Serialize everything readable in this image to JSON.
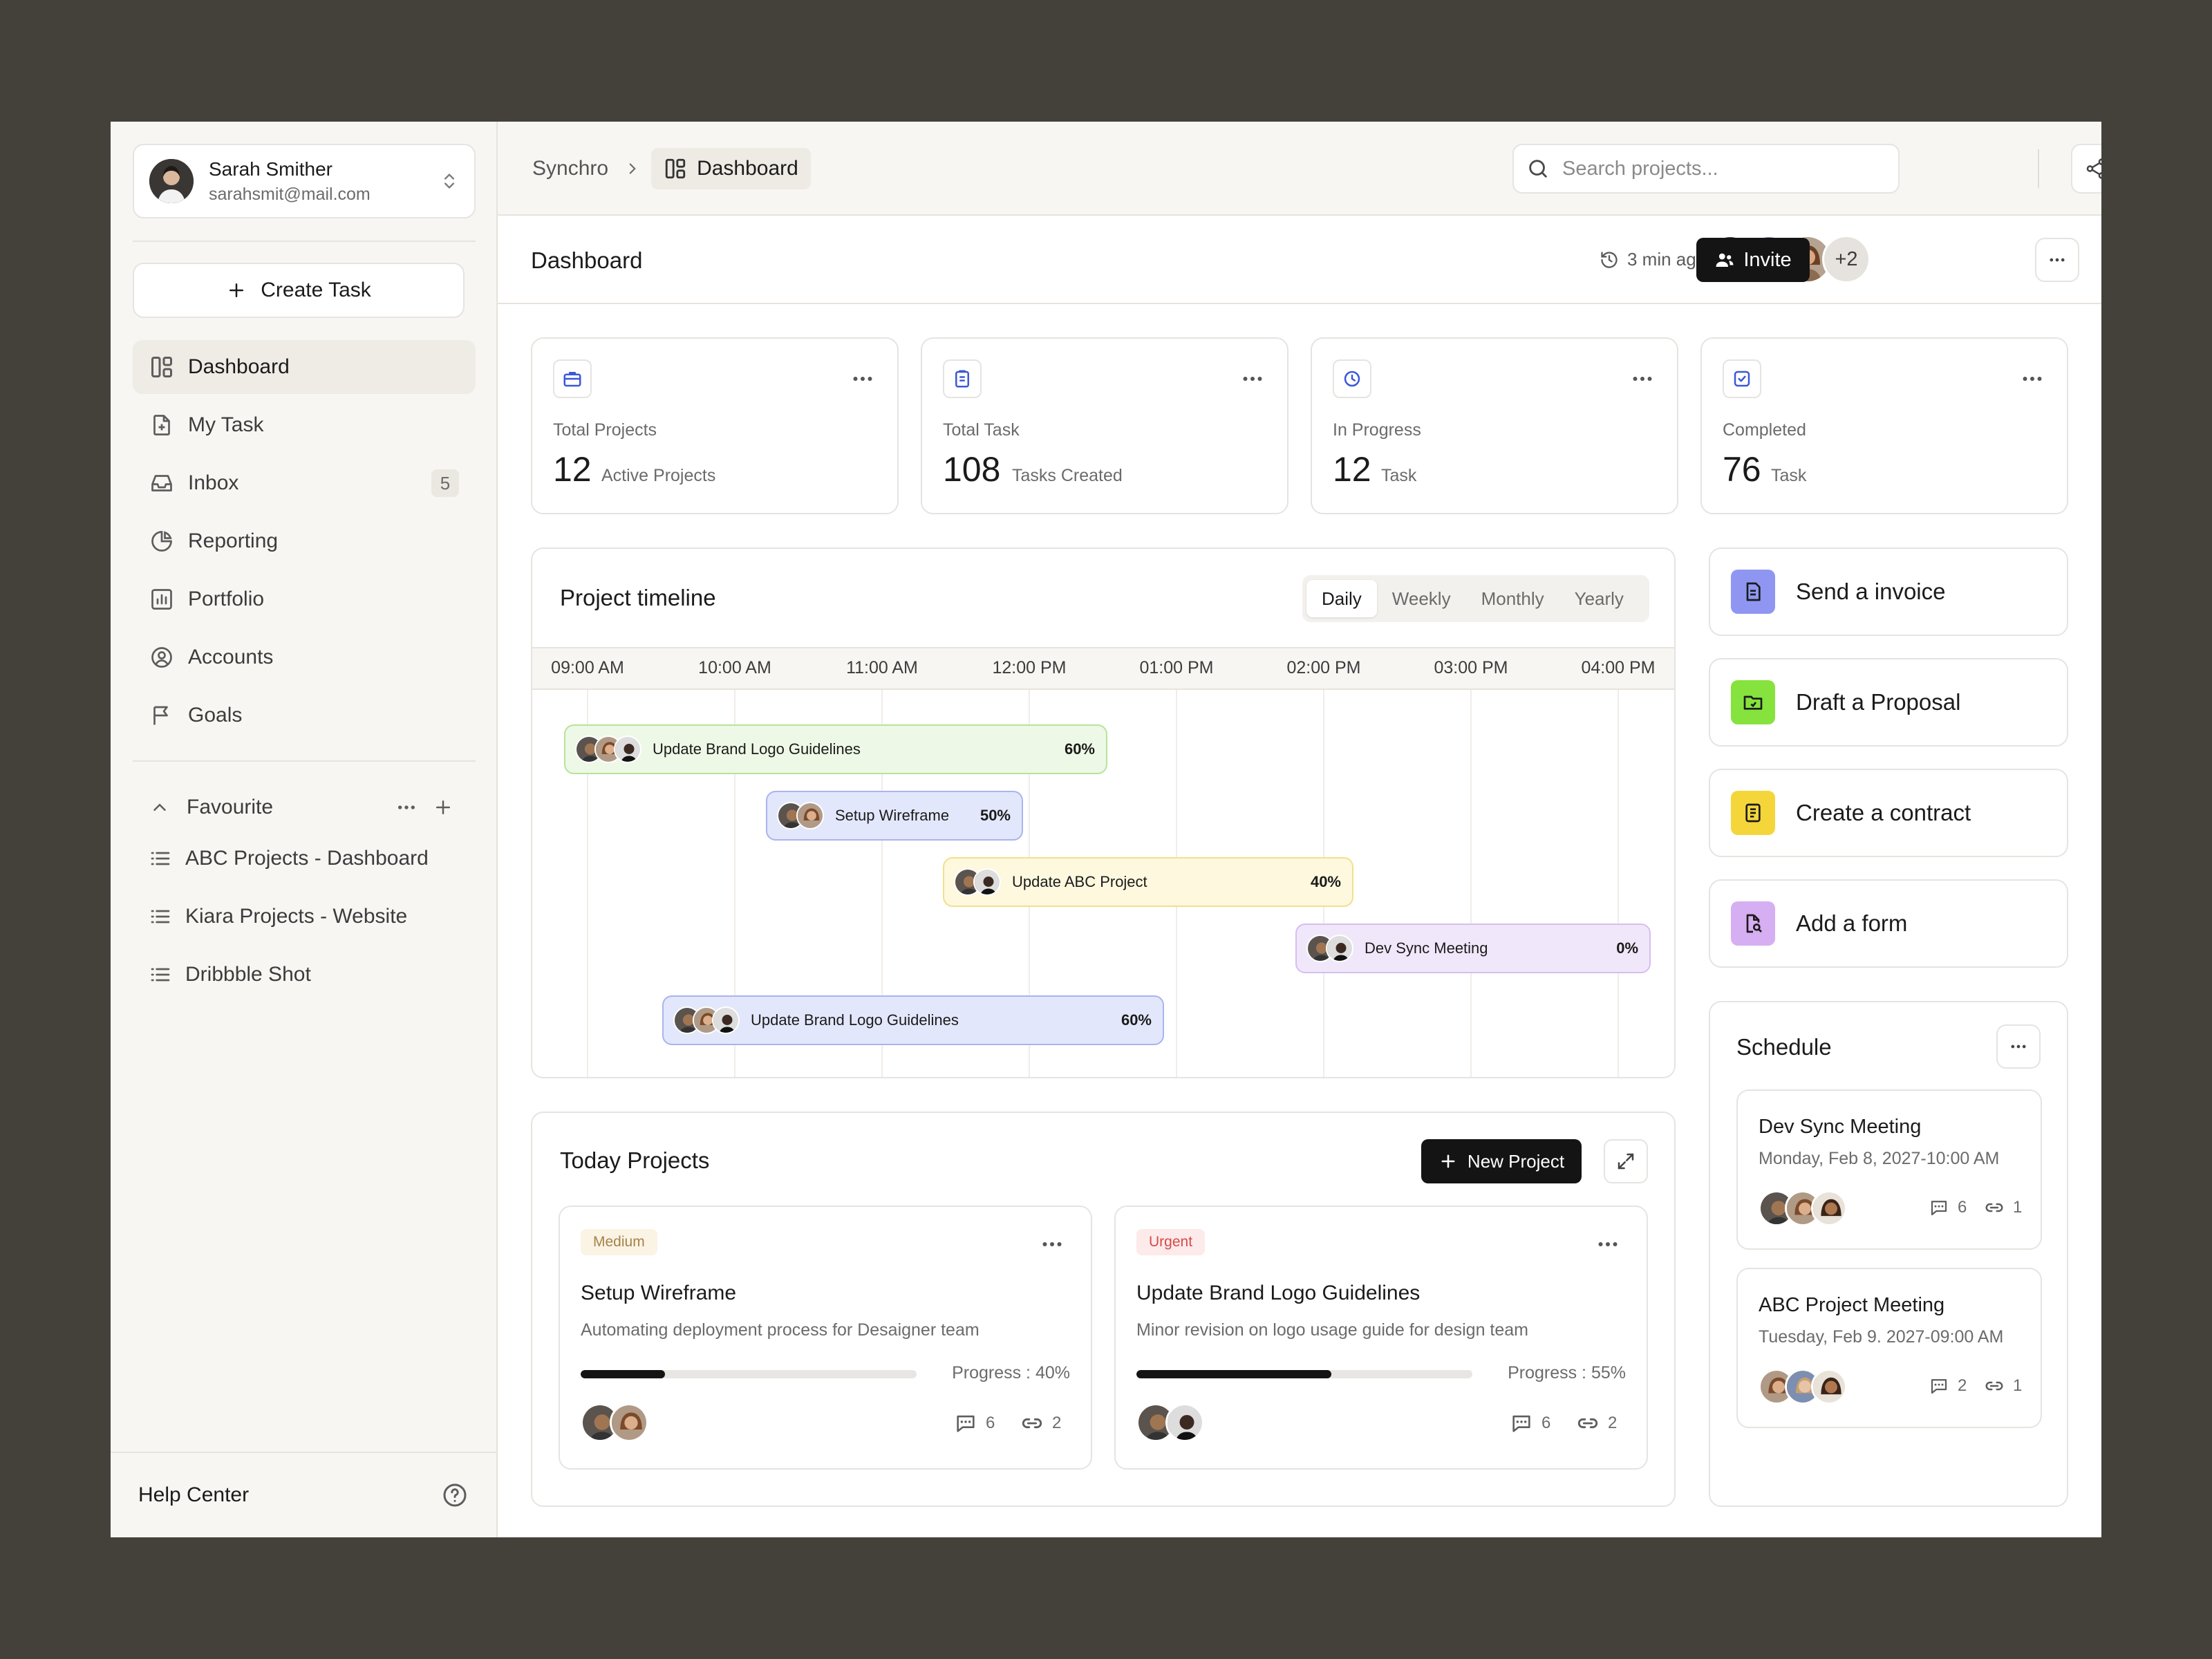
{
  "user": {
    "name": "Sarah Smither",
    "email": "sarahsmit@mail.com"
  },
  "sidebar": {
    "create_task": "Create Task",
    "nav": [
      {
        "label": "Dashboard",
        "icon": "layout-icon",
        "active": true
      },
      {
        "label": "My Task",
        "icon": "file-plus-icon"
      },
      {
        "label": "Inbox",
        "icon": "inbox-icon",
        "badge": "5"
      },
      {
        "label": "Reporting",
        "icon": "pie-chart-icon"
      },
      {
        "label": "Portfolio",
        "icon": "bar-chart-icon"
      },
      {
        "label": "Accounts",
        "icon": "user-circle-icon"
      },
      {
        "label": "Goals",
        "icon": "flag-icon"
      }
    ],
    "favourite": {
      "label": "Favourite",
      "items": [
        "ABC Projects - Dashboard",
        "Kiara Projects - Website",
        "Dribbble Shot"
      ]
    },
    "help": "Help Center"
  },
  "topbar": {
    "breadcrumb": [
      "Synchro",
      "Dashboard"
    ],
    "search_placeholder": "Search projects..."
  },
  "header": {
    "title": "Dashboard",
    "updated": "3 min ago",
    "extra_members": "+2",
    "invite": "Invite"
  },
  "stats": [
    {
      "label": "Total Projects",
      "value": "12",
      "sub": "Active Projects",
      "icon": "briefcase-icon"
    },
    {
      "label": "Total Task",
      "value": "108",
      "sub": "Tasks Created",
      "icon": "clipboard-icon"
    },
    {
      "label": "In Progress",
      "value": "12",
      "sub": "Task",
      "icon": "clock-icon"
    },
    {
      "label": "Completed",
      "value": "76",
      "sub": "Task",
      "icon": "check-square-icon"
    }
  ],
  "timeline": {
    "title": "Project timeline",
    "tabs": [
      "Daily",
      "Weekly",
      "Monthly",
      "Yearly"
    ],
    "active_tab": "Daily",
    "hours": [
      "09:00 AM",
      "10:00 AM",
      "11:00 AM",
      "12:00 PM",
      "01:00 PM",
      "02:00 PM",
      "03:00 PM",
      "04:00 PM"
    ],
    "tasks": [
      {
        "name": "Update Brand Logo Guidelines",
        "percent": "60%",
        "color": "#eef8e6",
        "border": "#b7e39a"
      },
      {
        "name": "Setup Wireframe",
        "percent": "50%",
        "color": "#e3e7fb",
        "border": "#a9b4ee"
      },
      {
        "name": "Update ABC Project",
        "percent": "40%",
        "color": "#fdf8de",
        "border": "#f1e08b"
      },
      {
        "name": "Dev Sync Meeting",
        "percent": "0%",
        "color": "#f1e7fa",
        "border": "#d7bdf0"
      },
      {
        "name": "Update Brand Logo Guidelines",
        "percent": "60%",
        "color": "#e3e7fb",
        "border": "#a9b4ee"
      }
    ]
  },
  "today": {
    "title": "Today Projects",
    "new_project": "New Project",
    "projects": [
      {
        "tag": "Medium",
        "tag_color": "#a5834a",
        "tag_bg": "#fbf3e4",
        "title": "Setup Wireframe",
        "desc": "Automating deployment process for Desaigner team",
        "progress_label": "Progress : 40%",
        "progress": 0.25,
        "comments": "6",
        "links": "2"
      },
      {
        "tag": "Urgent",
        "tag_color": "#d64a4a",
        "tag_bg": "#fdeaea",
        "title": "Update Brand Logo Guidelines",
        "desc": "Minor revision on logo usage guide for design team",
        "progress_label": "Progress : 55%",
        "progress": 0.58,
        "comments": "6",
        "links": "2"
      }
    ]
  },
  "actions": [
    {
      "label": "Send a invoice",
      "icon": "invoice-icon",
      "bg": "#8f96f2"
    },
    {
      "label": "Draft a Proposal",
      "icon": "folder-icon",
      "bg": "#86e23d"
    },
    {
      "label": "Create a contract",
      "icon": "document-icon",
      "bg": "#f4d63a"
    },
    {
      "label": "Add a form",
      "icon": "file-search-icon",
      "bg": "#d6aef2"
    }
  ],
  "schedule": {
    "title": "Schedule",
    "items": [
      {
        "name": "Dev Sync Meeting",
        "date": "Monday, Feb 8, 2027-10:00 AM",
        "comments": "6",
        "links": "1"
      },
      {
        "name": "ABC Project Meeting",
        "date": "Tuesday, Feb 9. 2027-09:00 AM",
        "comments": "2",
        "links": "1"
      }
    ]
  }
}
